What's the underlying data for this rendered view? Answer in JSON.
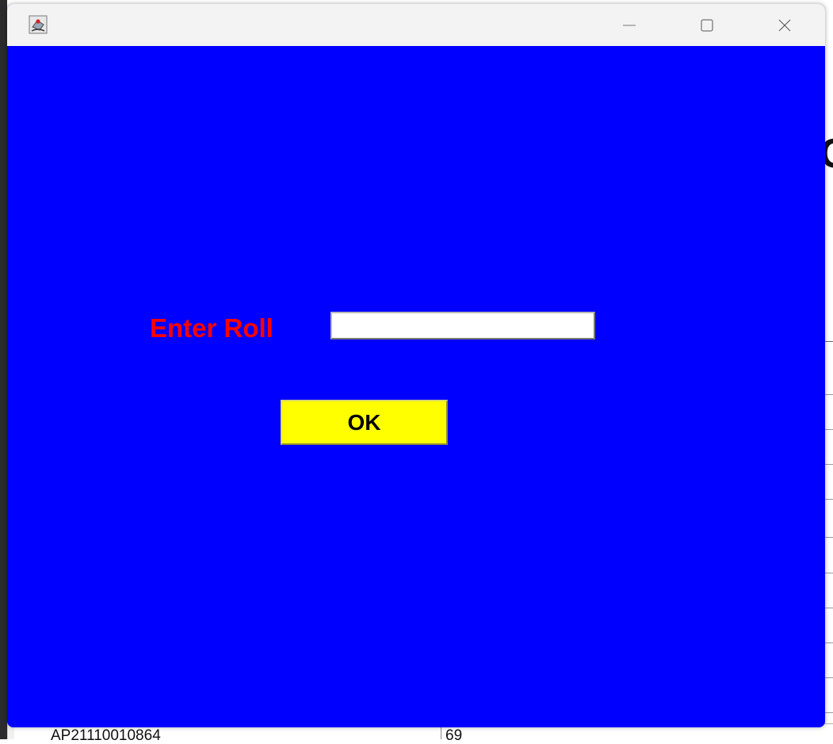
{
  "background_window": {
    "partial_glyph": "C",
    "table_row": {
      "id_cell": "AP21110010864",
      "value_cell": "69"
    }
  },
  "dialog": {
    "title": "",
    "app_icon": "java-cup-icon",
    "controls": {
      "minimize_icon": "minimize-icon",
      "maximize_icon": "maximize-icon",
      "close_icon": "close-icon"
    },
    "background_color": "#0000ff",
    "form": {
      "roll_label": "Enter Roll",
      "roll_label_color": "#ff0000",
      "roll_input_value": "",
      "ok_label": "OK",
      "ok_button_color": "#ffff00"
    }
  }
}
